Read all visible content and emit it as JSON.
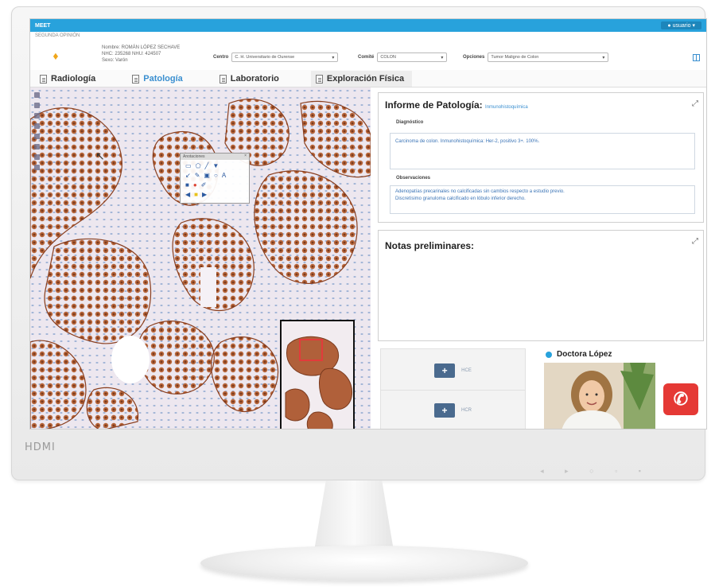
{
  "monitor": {
    "brand": "HDMI",
    "controls": "◂ ▸ ○ ▫ ▪"
  },
  "app": {
    "logo": "MEET",
    "user_menu": "● usuario ▾",
    "breadcrumb": "SEGUNDA OPINIÓN"
  },
  "patient": {
    "line1": "Nombre: ROMÁN LÓPEZ SECHAVE",
    "line2": "NHC: 235268  NHU: 424507",
    "line3": "Sexo: Varón",
    "centro_label": "Centro",
    "centro_value": "C. H. Universitario de Ourense",
    "comite_label": "Comité",
    "comite_value": "COLON",
    "opciones_label": "Opciones",
    "opciones_value": "Tumor Maligno de Colon"
  },
  "tabs": [
    {
      "label": "Radiología"
    },
    {
      "label": "Patología"
    },
    {
      "label": "Laboratorio"
    },
    {
      "label": "Exploración Física"
    }
  ],
  "annotation_panel": {
    "title": "Anotaciones",
    "close": "×"
  },
  "report": {
    "title": "Informe de Patología:",
    "subtitle": "Inmunohistoquímica",
    "diag_label": "Diagnóstico",
    "diag_text": "Carcinoma de colon. Inmunohistoquímica: Her-2, positivo 3+. 100%.",
    "obs_label": "Observaciones",
    "obs_text_1": "Adenopatías precarinales no calcificadas sin cambios respecto a estudio previo.",
    "obs_text_2": "Discretísimo granuloma calcificado en lóbulo inferior derecho."
  },
  "notes": {
    "title": "Notas preliminares:"
  },
  "history": {
    "hce": "HCE",
    "hcr": "HCR"
  },
  "doctor": {
    "name": "Doctora López"
  },
  "colors": {
    "accent": "#28a2dc",
    "call": "#e53935",
    "stain": "#a8552f"
  }
}
